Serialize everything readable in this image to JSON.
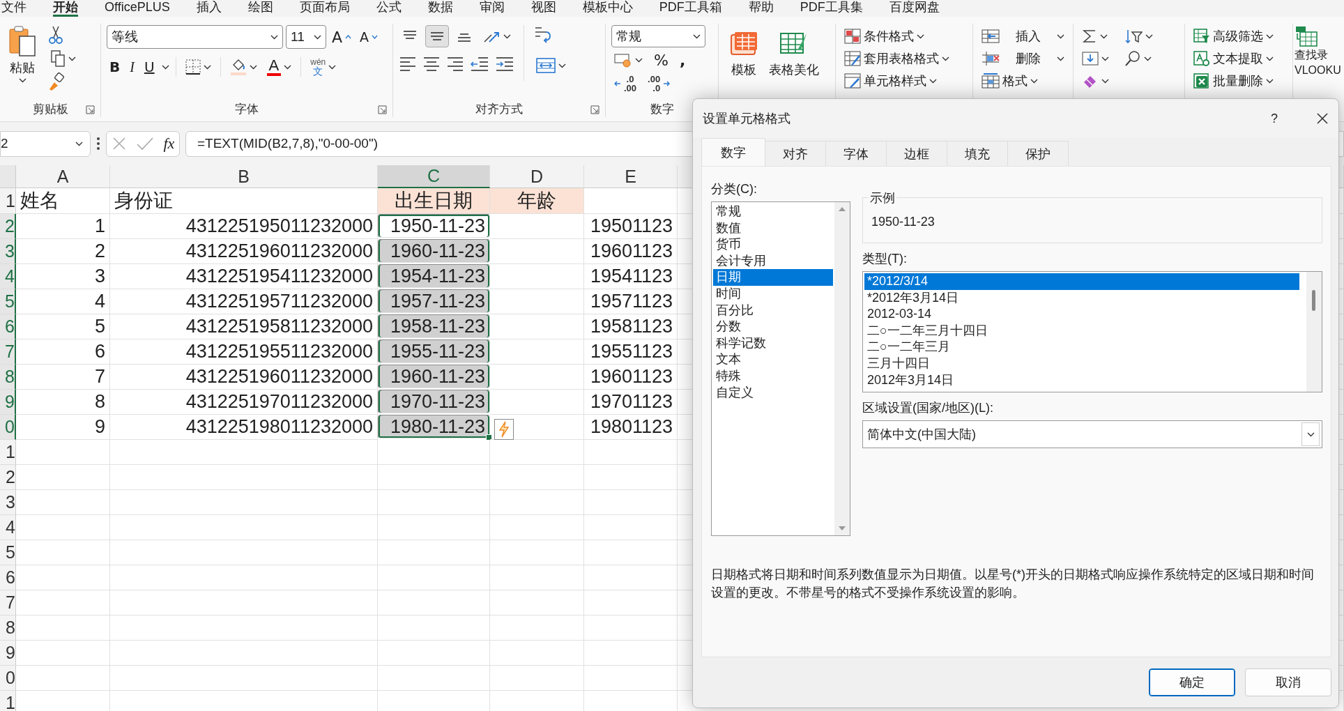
{
  "menu_tabs": [
    {
      "label": "文件",
      "selected": false
    },
    {
      "label": "开始",
      "selected": true
    },
    {
      "label": "OfficePLUS",
      "selected": false
    },
    {
      "label": "插入",
      "selected": false
    },
    {
      "label": "绘图",
      "selected": false
    },
    {
      "label": "页面布局",
      "selected": false
    },
    {
      "label": "公式",
      "selected": false
    },
    {
      "label": "数据",
      "selected": false
    },
    {
      "label": "审阅",
      "selected": false
    },
    {
      "label": "视图",
      "selected": false
    },
    {
      "label": "模板中心",
      "selected": false
    },
    {
      "label": "PDF工具箱",
      "selected": false
    },
    {
      "label": "帮助",
      "selected": false
    },
    {
      "label": "PDF工具集",
      "selected": false
    },
    {
      "label": "百度网盘",
      "selected": false
    }
  ],
  "ribbon": {
    "clipboard": {
      "paste_label": "粘贴",
      "group_label": "剪贴板"
    },
    "font": {
      "font_name": "等线",
      "font_size": "11",
      "grow_label": "A",
      "shrink_label": "A",
      "format_buttons": [
        {
          "label": "B",
          "kind": "bold"
        },
        {
          "label": "I",
          "kind": "italic"
        },
        {
          "label": "U",
          "kind": "underline"
        }
      ],
      "font_color_label": "A",
      "phonetic_top": "wén",
      "phonetic_bottom": "文",
      "group_label": "字体"
    },
    "alignment": {
      "vertical_buttons": [
        {
          "selected": false
        },
        {
          "selected": true
        },
        {
          "selected": false
        }
      ],
      "group_label": "对齐方式"
    },
    "number": {
      "format": "常规",
      "percent_label": "%",
      "comma_label": ",",
      "increase_decimal": [
        ".0",
        ".00"
      ],
      "decrease_decimal": [
        ".00",
        ".0"
      ],
      "group_label": "数字"
    },
    "templates": [
      {
        "label": "模板",
        "kind": "template"
      },
      {
        "label": "表格美化",
        "kind": "beautify"
      }
    ],
    "styles": [
      {
        "label": "条件格式",
        "kind": "conditional"
      },
      {
        "label": "套用表格格式",
        "kind": "table"
      },
      {
        "label": "单元格样式",
        "kind": "cell"
      }
    ],
    "cells": [
      {
        "label": "插入",
        "kind": "insert"
      },
      {
        "label": "删除",
        "kind": "delete"
      },
      {
        "label": "格式",
        "kind": "format"
      }
    ],
    "tools": [
      {
        "label": "高级筛选",
        "kind": "filter"
      },
      {
        "label": "文本提取",
        "kind": "extract"
      },
      {
        "label": "批量删除",
        "kind": "batch_delete"
      }
    ],
    "lookup": {
      "line1": "查找录",
      "line2": "VLOOKU"
    }
  },
  "formula_bar": {
    "name_box": "2",
    "function_label": "fx",
    "formula": "=TEXT(MID(B2,7,8),\"0-00-00\")"
  },
  "sheet": {
    "columns": [
      {
        "label": "A",
        "selected": false
      },
      {
        "label": "B",
        "selected": false
      },
      {
        "label": "C",
        "selected": true
      },
      {
        "label": "D",
        "selected": false
      },
      {
        "label": "E",
        "selected": false
      }
    ],
    "rows": [
      {
        "number": "1",
        "selected": false,
        "cells": [
          {
            "text": "姓名",
            "kind": "text"
          },
          {
            "text": "身份证",
            "kind": "text"
          },
          {
            "text": "出生日期",
            "kind": "header",
            "color": "#fbe2d5"
          },
          {
            "text": "年龄",
            "kind": "header",
            "color": "#fbe2d5"
          },
          {}
        ]
      },
      {
        "number": "2",
        "selected": true,
        "cells": [
          {
            "text": "1",
            "kind": "number"
          },
          {
            "text": "431225195011232000",
            "kind": "number"
          },
          {
            "text": "1950-11-23",
            "kind": "number",
            "selected": true,
            "active": true
          },
          {},
          {
            "text": "19501123",
            "kind": "number"
          }
        ]
      },
      {
        "number": "3",
        "selected": true,
        "cells": [
          {
            "text": "2",
            "kind": "number"
          },
          {
            "text": "431225196011232000",
            "kind": "number"
          },
          {
            "text": "1960-11-23",
            "kind": "number",
            "selected": true,
            "active": false
          },
          {},
          {
            "text": "19601123",
            "kind": "number"
          }
        ]
      },
      {
        "number": "4",
        "selected": true,
        "cells": [
          {
            "text": "3",
            "kind": "number"
          },
          {
            "text": "431225195411232000",
            "kind": "number"
          },
          {
            "text": "1954-11-23",
            "kind": "number",
            "selected": true,
            "active": false
          },
          {},
          {
            "text": "19541123",
            "kind": "number"
          }
        ]
      },
      {
        "number": "5",
        "selected": true,
        "cells": [
          {
            "text": "4",
            "kind": "number"
          },
          {
            "text": "431225195711232000",
            "kind": "number"
          },
          {
            "text": "1957-11-23",
            "kind": "number",
            "selected": true,
            "active": false
          },
          {},
          {
            "text": "19571123",
            "kind": "number"
          }
        ]
      },
      {
        "number": "6",
        "selected": true,
        "cells": [
          {
            "text": "5",
            "kind": "number"
          },
          {
            "text": "431225195811232000",
            "kind": "number"
          },
          {
            "text": "1958-11-23",
            "kind": "number",
            "selected": true,
            "active": false
          },
          {},
          {
            "text": "19581123",
            "kind": "number"
          }
        ]
      },
      {
        "number": "7",
        "selected": true,
        "cells": [
          {
            "text": "6",
            "kind": "number"
          },
          {
            "text": "431225195511232000",
            "kind": "number"
          },
          {
            "text": "1955-11-23",
            "kind": "number",
            "selected": true,
            "active": false
          },
          {},
          {
            "text": "19551123",
            "kind": "number"
          }
        ]
      },
      {
        "number": "8",
        "selected": true,
        "cells": [
          {
            "text": "7",
            "kind": "number"
          },
          {
            "text": "431225196011232000",
            "kind": "number"
          },
          {
            "text": "1960-11-23",
            "kind": "number",
            "selected": true,
            "active": false
          },
          {},
          {
            "text": "19601123",
            "kind": "number"
          }
        ]
      },
      {
        "number": "9",
        "selected": true,
        "cells": [
          {
            "text": "8",
            "kind": "number"
          },
          {
            "text": "431225197011232000",
            "kind": "number"
          },
          {
            "text": "1970-11-23",
            "kind": "number",
            "selected": true,
            "active": false
          },
          {},
          {
            "text": "19701123",
            "kind": "number"
          }
        ]
      },
      {
        "number": "0",
        "selected": true,
        "cells": [
          {
            "text": "9",
            "kind": "number"
          },
          {
            "text": "431225198011232000",
            "kind": "number"
          },
          {
            "text": "1980-11-23",
            "kind": "number",
            "selected": true,
            "active": false
          },
          {
            "flash_fill": true
          },
          {
            "text": "19801123",
            "kind": "number"
          }
        ]
      },
      {
        "number": "1",
        "selected": false
      },
      {
        "number": "2",
        "selected": false
      },
      {
        "number": "3",
        "selected": false
      },
      {
        "number": "4",
        "selected": false
      },
      {
        "number": "5",
        "selected": false
      },
      {
        "number": "6",
        "selected": false
      },
      {
        "number": "7",
        "selected": false
      },
      {
        "number": "8",
        "selected": false
      },
      {
        "number": "9",
        "selected": false
      },
      {
        "number": "0",
        "selected": false
      },
      {
        "number": "1",
        "selected": false
      }
    ]
  },
  "dialog": {
    "title": "设置单元格格式",
    "help_label": "?",
    "tabs": [
      {
        "label": "数字",
        "selected": true
      },
      {
        "label": "对齐",
        "selected": false
      },
      {
        "label": "字体",
        "selected": false
      },
      {
        "label": "边框",
        "selected": false
      },
      {
        "label": "填充",
        "selected": false
      },
      {
        "label": "保护",
        "selected": false
      }
    ],
    "category_label": "分类(C):",
    "categories": [
      {
        "label": "常规",
        "selected": false
      },
      {
        "label": "数值",
        "selected": false
      },
      {
        "label": "货币",
        "selected": false
      },
      {
        "label": "会计专用",
        "selected": false
      },
      {
        "label": "日期",
        "selected": true
      },
      {
        "label": "时间",
        "selected": false
      },
      {
        "label": "百分比",
        "selected": false
      },
      {
        "label": "分数",
        "selected": false
      },
      {
        "label": "科学记数",
        "selected": false
      },
      {
        "label": "文本",
        "selected": false
      },
      {
        "label": "特殊",
        "selected": false
      },
      {
        "label": "自定义",
        "selected": false
      }
    ],
    "sample_label": "示例",
    "sample_value": "1950-11-23",
    "type_label": "类型(T):",
    "types": [
      {
        "label": "*2012/3/14",
        "selected": true
      },
      {
        "label": "*2012年3月14日",
        "selected": false
      },
      {
        "label": "2012-03-14",
        "selected": false
      },
      {
        "label": "二○一二年三月十四日",
        "selected": false
      },
      {
        "label": "二○一二年三月",
        "selected": false
      },
      {
        "label": "三月十四日",
        "selected": false
      },
      {
        "label": "2012年3月14日",
        "selected": false
      }
    ],
    "locale_label": "区域设置(国家/地区)(L):",
    "locale_value": "简体中文(中国大陆)",
    "description": "日期格式将日期和时间系列数值显示为日期值。以星号(*)开头的日期格式响应操作系统特定的区域日期和时间设置的更改。不带星号的格式不受操作系统设置的影响。",
    "buttons": [
      {
        "label": "确定",
        "kind": "primary"
      },
      {
        "label": "取消",
        "kind": "secondary"
      }
    ]
  }
}
